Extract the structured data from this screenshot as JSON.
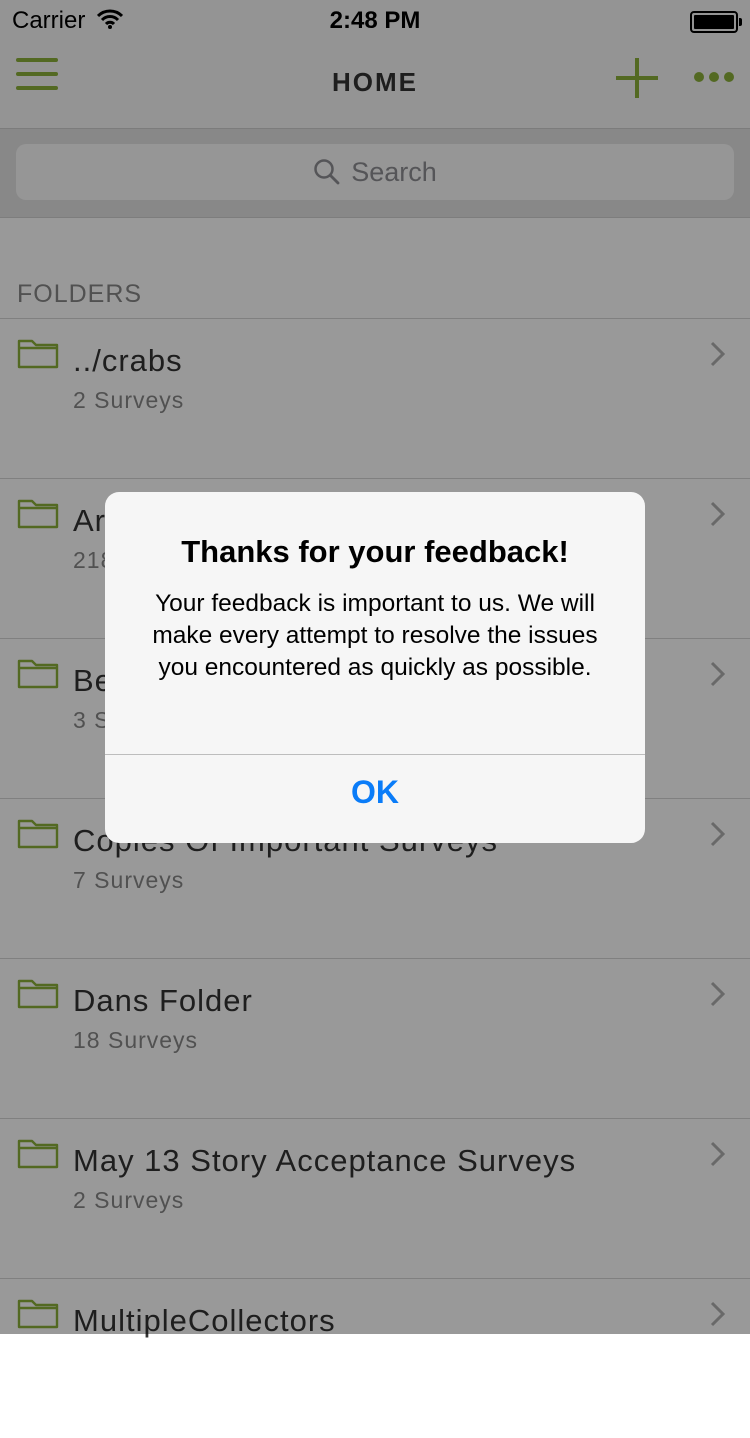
{
  "status_bar": {
    "carrier": "Carrier",
    "time": "2:48 PM"
  },
  "nav": {
    "title": "HOME",
    "menu_icon": "hamburger-menu-icon",
    "add_icon": "plus-icon",
    "more_icon": "more-dots-icon"
  },
  "search": {
    "placeholder": "Search"
  },
  "section": {
    "header": "FOLDERS"
  },
  "folders": [
    {
      "title": "../crabs",
      "subtitle": "2 Surveys"
    },
    {
      "title": "Ar",
      "subtitle": "218"
    },
    {
      "title": "Be",
      "subtitle": "3 S"
    },
    {
      "title": "Copies Of Important Surveys",
      "subtitle": "7 Surveys"
    },
    {
      "title": "Dans Folder",
      "subtitle": "18 Surveys"
    },
    {
      "title": "May 13 Story Acceptance Surveys",
      "subtitle": "2 Surveys"
    },
    {
      "title": "MultipleCollectors",
      "subtitle": ""
    }
  ],
  "alert": {
    "title": "Thanks for your feedback!",
    "message": "Your feedback is important to us. We will make every attempt to resolve the issues you encountered as quickly as possible.",
    "ok_label": "OK"
  },
  "colors": {
    "accent": "#8bb03a",
    "link": "#0a7cf8"
  }
}
